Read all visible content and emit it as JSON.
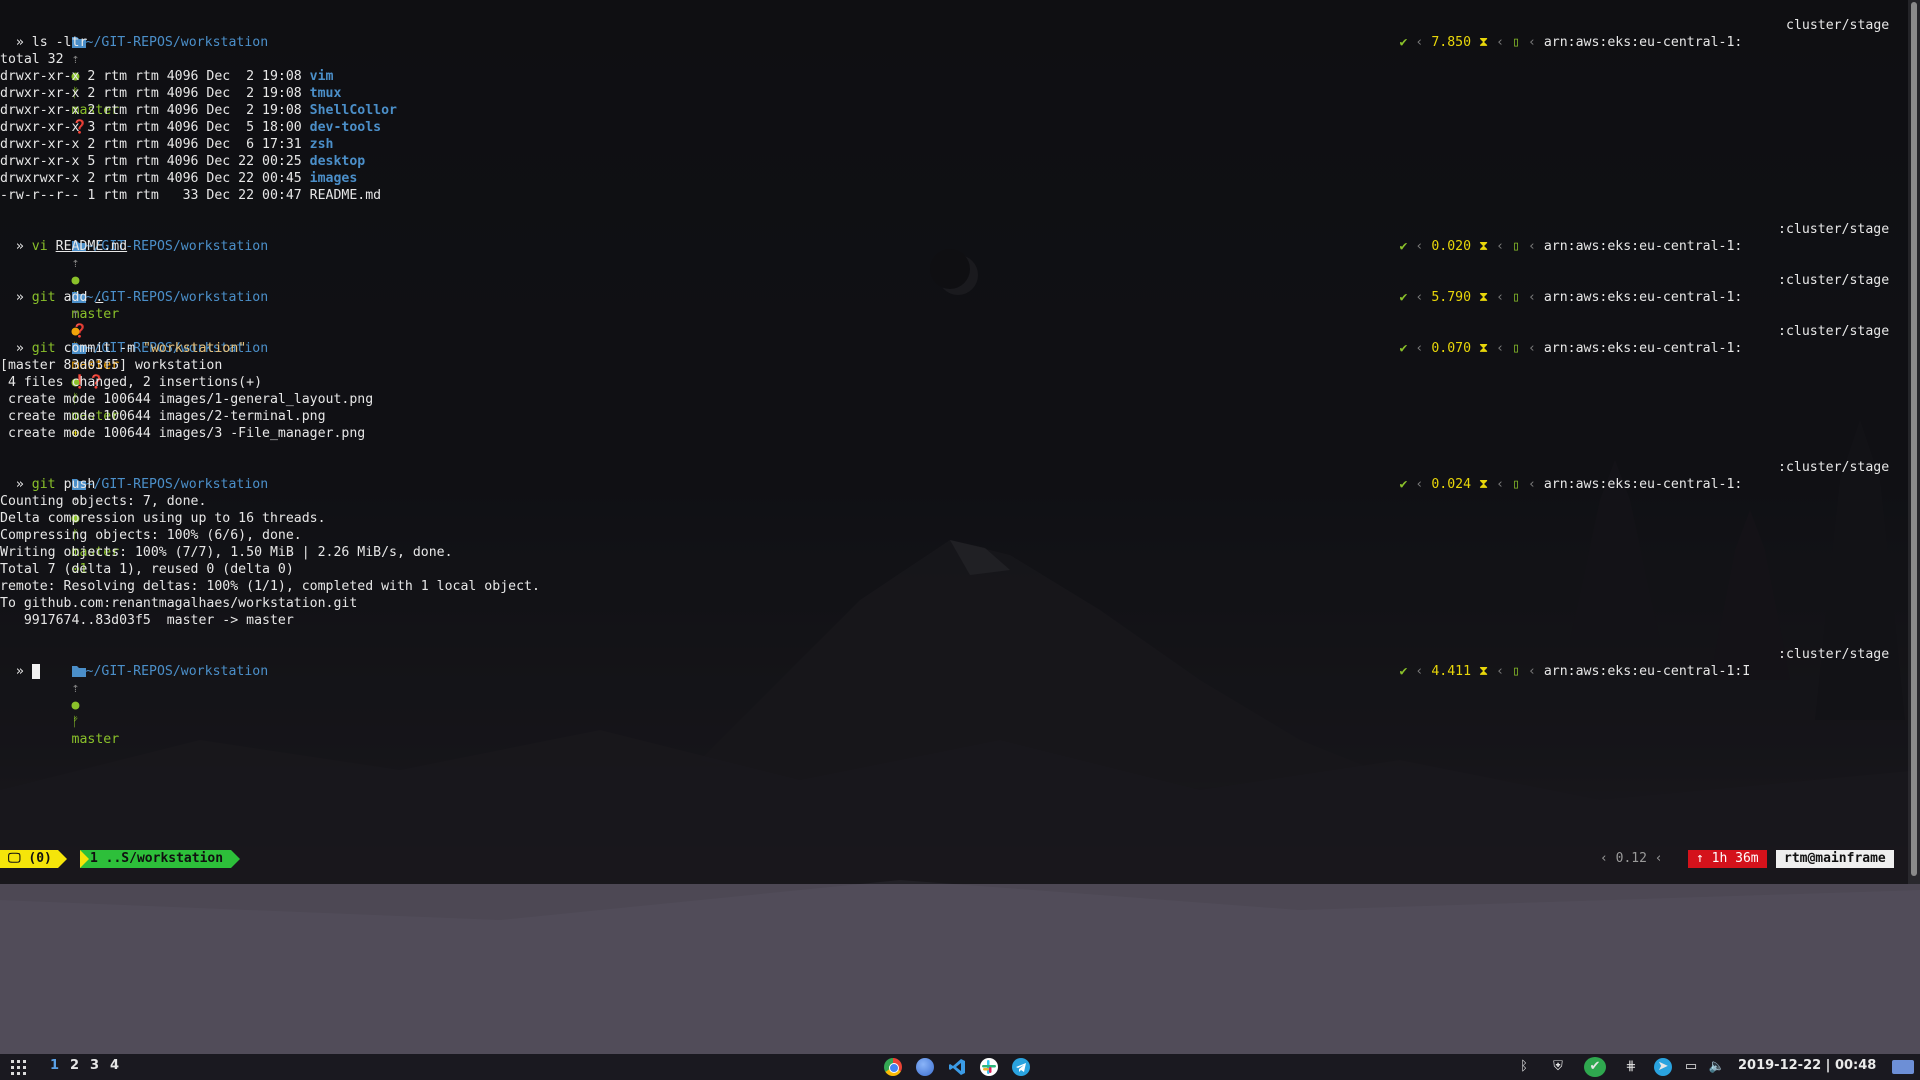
{
  "colors": {
    "path": "#4b8fc9",
    "git_branch": "#8ac12a",
    "timer": "#e8d60a",
    "session_bg": "#f5e50a",
    "window_bg": "#2dbf3a",
    "uptime_bg": "#d4121b",
    "host_bg": "#efefef",
    "workspace_active": "#5aa0e6"
  },
  "prompts": [
    {
      "path": "~/GIT-REPOS/workstation",
      "branch": "master",
      "status_icon": "question-icon",
      "status_text": "",
      "duration": "7.850",
      "aws_context": "arn:aws:eks:eu-central-1:",
      "namespace": "cluster/stage"
    },
    {
      "path": "~/GIT-REPOS/workstation",
      "branch": "master",
      "status_icon": "question-icon",
      "status_text": "",
      "duration": "0.020",
      "aws_context": "arn:aws:eks:eu-central-1:",
      "namespace": ":cluster/stage"
    },
    {
      "path": "~/GIT-REPOS/workstation",
      "branch": "master",
      "status_icon": "warning-question-icon",
      "status_text": "",
      "duration": "5.790",
      "aws_context": "arn:aws:eks:eu-central-1:",
      "namespace": ":cluster/stage"
    },
    {
      "path": "~/GIT-REPOS/workstation",
      "branch": "master",
      "status_icon": "plus-icon",
      "status_text": "",
      "duration": "0.070",
      "aws_context": "arn:aws:eks:eu-central-1:",
      "namespace": ":cluster/stage"
    },
    {
      "path": "~/GIT-REPOS/workstation",
      "branch": "master",
      "status_icon": "arrow-up-icon",
      "status_text": "1",
      "duration": "0.024",
      "aws_context": "arn:aws:eks:eu-central-1:",
      "namespace": ":cluster/stage"
    },
    {
      "path": "~/GIT-REPOS/workstation",
      "branch": "master",
      "status_icon": "",
      "status_text": "",
      "duration": "4.411",
      "aws_context": "arn:aws:eks:eu-central-1:I",
      "namespace": ":cluster/stage"
    }
  ],
  "commands": {
    "c1": "ls -ltr",
    "c2_cmd": "vi",
    "c2_arg": "README.md",
    "c3_cmd": "git",
    "c3_rest": "add",
    "c3_arg": ".",
    "c4_cmd": "git",
    "c4_rest": "commit -m",
    "c4_str": "\"workstation\"",
    "c5_cmd": "git",
    "c5_rest": "push",
    "arrow": "»"
  },
  "ls_output": {
    "total": "total 32",
    "rows": [
      {
        "meta": "drwxr-xr-x 2 rtm rtm 4096 Dec  2 19:08 ",
        "name": "vim",
        "dir": true
      },
      {
        "meta": "drwxr-xr-x 2 rtm rtm 4096 Dec  2 19:08 ",
        "name": "tmux",
        "dir": true
      },
      {
        "meta": "drwxr-xr-x 2 rtm rtm 4096 Dec  2 19:08 ",
        "name": "ShellCollor",
        "dir": true
      },
      {
        "meta": "drwxr-xr-x 3 rtm rtm 4096 Dec  5 18:00 ",
        "name": "dev-tools",
        "dir": true
      },
      {
        "meta": "drwxr-xr-x 2 rtm rtm 4096 Dec  6 17:31 ",
        "name": "zsh",
        "dir": true
      },
      {
        "meta": "drwxr-xr-x 5 rtm rtm 4096 Dec 22 00:25 ",
        "name": "desktop",
        "dir": true
      },
      {
        "meta": "drwxrwxr-x 2 rtm rtm 4096 Dec 22 00:45 ",
        "name": "images",
        "dir": true
      },
      {
        "meta": "-rw-r--r-- 1 rtm rtm   33 Dec 22 00:47 ",
        "name": "README.md",
        "dir": false
      }
    ]
  },
  "commit_output": [
    "[master 83d03f5] workstation",
    " 4 files changed, 2 insertions(+)",
    " create mode 100644 images/1-general_layout.png",
    " create mode 100644 images/2-terminal.png",
    " create mode 100644 images/3 -File_manager.png"
  ],
  "push_output": [
    "Counting objects: 7, done.",
    "Delta compression using up to 16 threads.",
    "Compressing objects: 100% (6/6), done.",
    "Writing objects: 100% (7/7), 1.50 MiB | 2.26 MiB/s, done.",
    "Total 7 (delta 1), reused 0 (delta 0)",
    "remote: Resolving deltas: 100% (1/1), completed with 1 local object.",
    "To github.com:renantmagalhaes/workstation.git",
    "   9917674..83d03f5  master -> master"
  ],
  "tmux": {
    "session": "(0)",
    "window": "1 ..S/workstation",
    "load": "0.12",
    "uptime": "1h 36m",
    "host": "rtm@mainframe"
  },
  "panel": {
    "workspaces": [
      "1",
      "2",
      "3",
      "4"
    ],
    "active_workspace": "1",
    "dock": [
      "chrome-icon",
      "browser-icon",
      "vscode-icon",
      "slack-icon",
      "telegram-icon"
    ],
    "tray": [
      "bluetooth-icon",
      "shield-icon",
      "check-icon",
      "network-icon",
      "telegram-tray-icon",
      "display-icon",
      "volume-icon"
    ],
    "clock": "2019-12-22 | 00:48"
  }
}
